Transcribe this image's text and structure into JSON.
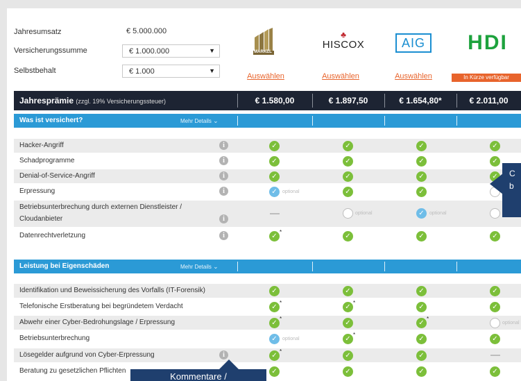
{
  "params": [
    {
      "label": "Jahresumsatz",
      "value": "€ 5.000.000"
    },
    {
      "label": "Versicherungssumme",
      "value": "€ 1.000.000"
    },
    {
      "label": "Selbstbehalt",
      "value": "€ 1.000"
    }
  ],
  "insurers": [
    {
      "name": "MARKEL",
      "action": "Auswählen",
      "price": "€ 1.580,00"
    },
    {
      "name": "HISCOX",
      "action": "Auswählen",
      "price": "€ 1.897,50"
    },
    {
      "name": "AIG",
      "action": "Auswählen",
      "price": "€ 1.654,80*"
    },
    {
      "name": "HDI",
      "action": "In Kürze verfügbar",
      "price": "€ 2.011,00"
    }
  ],
  "premium": {
    "label": "Jahresprämie",
    "note": "(zzgl. 19% Versicherungssteuer)"
  },
  "sections": [
    {
      "title": "Was ist versichert?",
      "more": "Mehr Details"
    },
    {
      "title": "Leistung bei Eigenschäden",
      "more": "Mehr Details"
    }
  ],
  "optional_label": "optional",
  "rows1": [
    "Hacker-Angriff",
    "Schadprogramme",
    "Denial-of-Service-Angriff",
    "Erpressung",
    "Betriebsunterbrechung durch externen Dienstleister /",
    "Cloudanbieter",
    "Datenrechtverletzung"
  ],
  "rows2": [
    "Identifikation und Beweissicherung des Vorfalls (IT-Forensik)",
    "Telefonische Erstberatung bei begründetem Verdacht",
    "Abwehr einer Cyber-Bedrohungslage / Erpressung",
    "Betriebsunterbrechung",
    "Lösegelder aufgrund von Cyber-Erpressung",
    "Beratung zu gesetzlichen Pflichten"
  ],
  "tooltip_bottom": "Kommentare /",
  "colors": {
    "accent_blue": "#2b9ad6",
    "dark_navy": "#1d2433",
    "orange": "#e8642c",
    "check_green": "#7cbf3a",
    "optional_blue": "#6fbde8",
    "tooltip_navy": "#1f3f6e"
  }
}
